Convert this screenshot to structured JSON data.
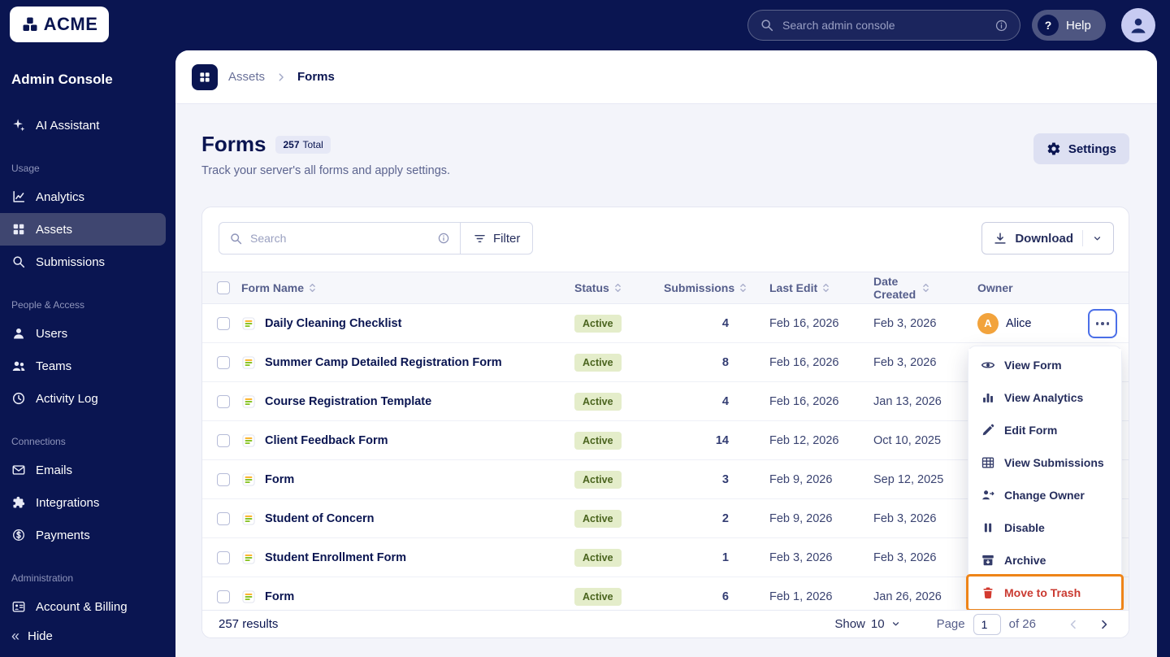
{
  "topbar": {
    "brand": "ACME",
    "search_placeholder": "Search admin console",
    "help_label": "Help"
  },
  "sidebar": {
    "title": "Admin Console",
    "assistant": {
      "label": "AI Assistant"
    },
    "sections": [
      {
        "label": "Usage",
        "items": [
          {
            "label": "Analytics"
          },
          {
            "label": "Assets",
            "active": true
          },
          {
            "label": "Submissions"
          }
        ]
      },
      {
        "label": "People & Access",
        "items": [
          {
            "label": "Users"
          },
          {
            "label": "Teams"
          },
          {
            "label": "Activity Log"
          }
        ]
      },
      {
        "label": "Connections",
        "items": [
          {
            "label": "Emails"
          },
          {
            "label": "Integrations"
          },
          {
            "label": "Payments"
          }
        ]
      },
      {
        "label": "Administration",
        "items": [
          {
            "label": "Account & Billing"
          }
        ]
      }
    ],
    "hide_label": "Hide"
  },
  "breadcrumb": {
    "parent": "Assets",
    "current": "Forms"
  },
  "page": {
    "title": "Forms",
    "total_count": "257",
    "total_label": "Total",
    "subtitle": "Track your server's all forms and apply settings.",
    "settings_label": "Settings"
  },
  "toolbar": {
    "search_placeholder": "Search",
    "filter_label": "Filter",
    "download_label": "Download"
  },
  "table": {
    "columns": [
      "Form Name",
      "Status",
      "Submissions",
      "Last Edit",
      "Date Created",
      "Owner"
    ],
    "rows": [
      {
        "name": "Daily Cleaning Checklist",
        "status": "Active",
        "submissions": "4",
        "last_edit": "Feb 16, 2026",
        "date_created": "Feb 3, 2026",
        "owner": "Alice",
        "owner_initial": "A"
      },
      {
        "name": "Summer Camp Detailed Registration Form",
        "status": "Active",
        "submissions": "8",
        "last_edit": "Feb 16, 2026",
        "date_created": "Feb 3, 2026"
      },
      {
        "name": "Course Registration Template",
        "status": "Active",
        "submissions": "4",
        "last_edit": "Feb 16, 2026",
        "date_created": "Jan 13, 2026"
      },
      {
        "name": "Client Feedback Form",
        "status": "Active",
        "submissions": "14",
        "last_edit": "Feb 12, 2026",
        "date_created": "Oct 10, 2025"
      },
      {
        "name": "Form",
        "status": "Active",
        "submissions": "3",
        "last_edit": "Feb 9, 2026",
        "date_created": "Sep 12, 2025"
      },
      {
        "name": "Student of Concern",
        "status": "Active",
        "submissions": "2",
        "last_edit": "Feb 9, 2026",
        "date_created": "Feb 3, 2026"
      },
      {
        "name": "Student Enrollment Form",
        "status": "Active",
        "submissions": "1",
        "last_edit": "Feb 3, 2026",
        "date_created": "Feb 3, 2026"
      },
      {
        "name": "Form",
        "status": "Active",
        "submissions": "6",
        "last_edit": "Feb 1, 2026",
        "date_created": "Jan 26, 2026"
      }
    ]
  },
  "menu": {
    "items": [
      {
        "label": "View Form"
      },
      {
        "label": "View Analytics"
      },
      {
        "label": "Edit Form"
      },
      {
        "label": "View Submissions"
      },
      {
        "label": "Change Owner"
      },
      {
        "label": "Disable"
      },
      {
        "label": "Archive"
      },
      {
        "label": "Move to Trash",
        "danger": true,
        "highlighted": true
      }
    ]
  },
  "footer": {
    "results": "257 results",
    "show_label": "Show",
    "show_value": "10",
    "page_label": "Page",
    "page_value": "1",
    "of_label": "of 26"
  },
  "colors": {
    "navy": "#0a1551",
    "content_bg": "#f3f4fa",
    "highlight_orange": "#ee8418",
    "danger_red": "#ca3a31",
    "active_badge_bg": "#e4edca",
    "active_badge_text": "#4a641e",
    "focus_blue": "#4b6fe8",
    "owner_avatar_orange": "#f2a33c"
  }
}
